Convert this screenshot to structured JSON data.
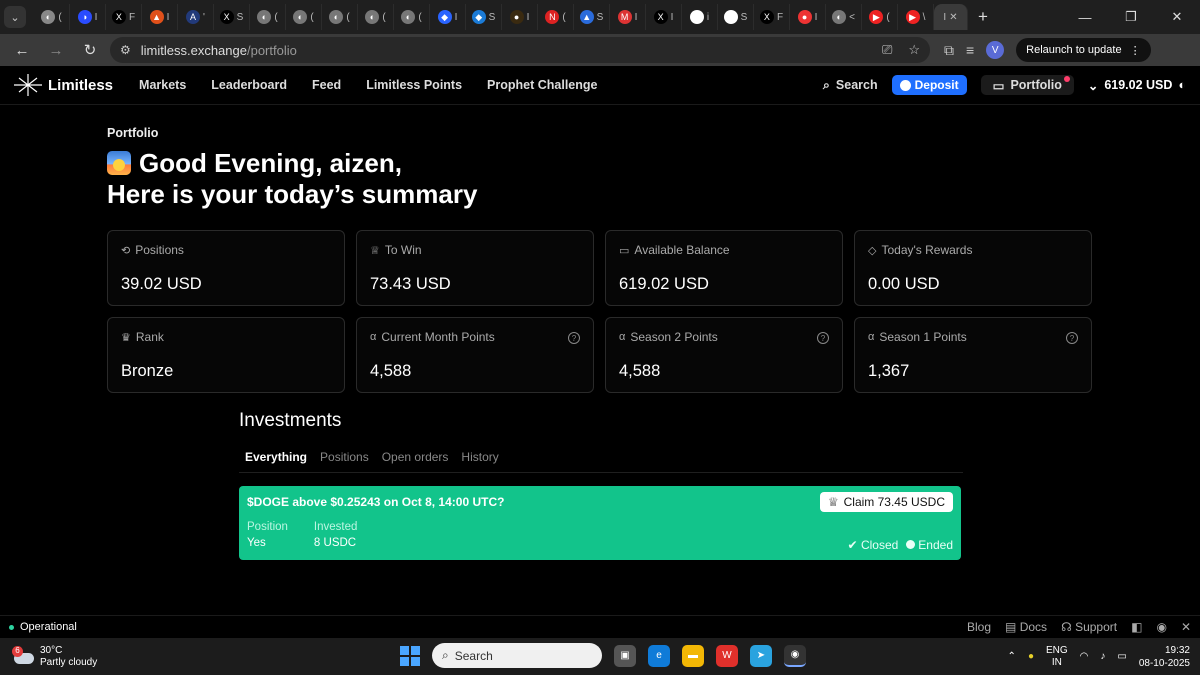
{
  "browser": {
    "tabs": [
      {
        "glyph": "◐",
        "color": "#888",
        "letter": "("
      },
      {
        "glyph": "◑",
        "color": "#2a4cff",
        "letter": "I"
      },
      {
        "glyph": "X",
        "color": "#000",
        "letter": "F"
      },
      {
        "glyph": "▲",
        "color": "#e0501a",
        "letter": "I"
      },
      {
        "glyph": "A",
        "color": "#223a7a",
        "letter": "'"
      },
      {
        "glyph": "X",
        "color": "#000",
        "letter": "S"
      },
      {
        "glyph": "◐",
        "color": "#777",
        "letter": "("
      },
      {
        "glyph": "◐",
        "color": "#777",
        "letter": "("
      },
      {
        "glyph": "◐",
        "color": "#777",
        "letter": "("
      },
      {
        "glyph": "◐",
        "color": "#777",
        "letter": "("
      },
      {
        "glyph": "◐",
        "color": "#777",
        "letter": "("
      },
      {
        "glyph": "◆",
        "color": "#2a64ff",
        "letter": "I"
      },
      {
        "glyph": "◆",
        "color": "#1b7bd6",
        "letter": "S"
      },
      {
        "glyph": "●",
        "color": "#3a2a10",
        "letter": "I"
      },
      {
        "glyph": "N",
        "color": "#d22",
        "letter": "("
      },
      {
        "glyph": "▲",
        "color": "#2a6bdb",
        "letter": "S"
      },
      {
        "glyph": "M",
        "color": "#d33",
        "letter": "I"
      },
      {
        "glyph": "X",
        "color": "#000",
        "letter": "I"
      },
      {
        "glyph": "◎",
        "color": "#fff",
        "letter": "i"
      },
      {
        "glyph": "◎",
        "color": "#fff",
        "letter": "S"
      },
      {
        "glyph": "X",
        "color": "#000",
        "letter": "F"
      },
      {
        "glyph": "●",
        "color": "#e33",
        "letter": "I"
      },
      {
        "glyph": "◐",
        "color": "#777",
        "letter": "<"
      },
      {
        "glyph": "▶",
        "color": "#e22",
        "letter": "("
      },
      {
        "glyph": "▶",
        "color": "#e22",
        "letter": "\\"
      }
    ],
    "active_tab_letter": "I",
    "url_host": "limitless.exchange",
    "url_path": "/portfolio",
    "relaunch_label": "Relaunch to update",
    "profile_letter": "V"
  },
  "nav": {
    "brand": "Limitless",
    "links": [
      "Markets",
      "Leaderboard",
      "Feed",
      "Limitless Points",
      "Prophet Challenge"
    ],
    "search_label": "Search",
    "deposit_label": "Deposit",
    "portfolio_label": "Portfolio",
    "balance": "619.02 USD"
  },
  "page": {
    "crumb": "Portfolio",
    "greeting_line1": "Good Evening, aizen,",
    "greeting_line2": "Here is your today’s summary"
  },
  "cards": [
    {
      "icon": "history-icon",
      "glyph": "⟲",
      "label": "Positions",
      "value": "39.02 USD",
      "help": false
    },
    {
      "icon": "trophy-icon",
      "glyph": "♕",
      "label": "To Win",
      "value": "73.43 USD",
      "help": false
    },
    {
      "icon": "wallet-icon",
      "glyph": "▭",
      "label": "Available Balance",
      "value": "619.02 USD",
      "help": false
    },
    {
      "icon": "diamond-icon",
      "glyph": "◇",
      "label": "Today's Rewards",
      "value": "0.00 USD",
      "help": false
    },
    {
      "icon": "medal-icon",
      "glyph": "♛",
      "label": "Rank",
      "value": "Bronze",
      "help": false
    },
    {
      "icon": "points-icon",
      "glyph": "α",
      "label": "Current Month Points",
      "value": "4,588",
      "help": true
    },
    {
      "icon": "points-icon",
      "glyph": "α",
      "label": "Season 2 Points",
      "value": "4,588",
      "help": true
    },
    {
      "icon": "points-icon",
      "glyph": "α",
      "label": "Season 1 Points",
      "value": "1,367",
      "help": true
    }
  ],
  "investments": {
    "title": "Investments",
    "tabs": [
      "Everything",
      "Positions",
      "Open orders",
      "History"
    ],
    "active_tab": "Everything",
    "market": {
      "title": "$DOGE above $0.25243 on Oct 8, 14:00 UTC?",
      "claim_label": "Claim 73.45 USDC",
      "position_header": "Position",
      "position_value": "Yes",
      "invested_header": "Invested",
      "invested_value": "8 USDC",
      "status_closed": "Closed",
      "status_ended": "Ended",
      "color": "#12c48b"
    }
  },
  "footer": {
    "status": "Operational",
    "links": [
      "Blog",
      "Docs",
      "Support"
    ]
  },
  "taskbar": {
    "temp": "30°C",
    "weather": "Partly cloudy",
    "weather_badge": "6",
    "search_placeholder": "Search",
    "lang1": "ENG",
    "lang2": "IN",
    "time": "19:32",
    "date": "08-10-2025"
  }
}
